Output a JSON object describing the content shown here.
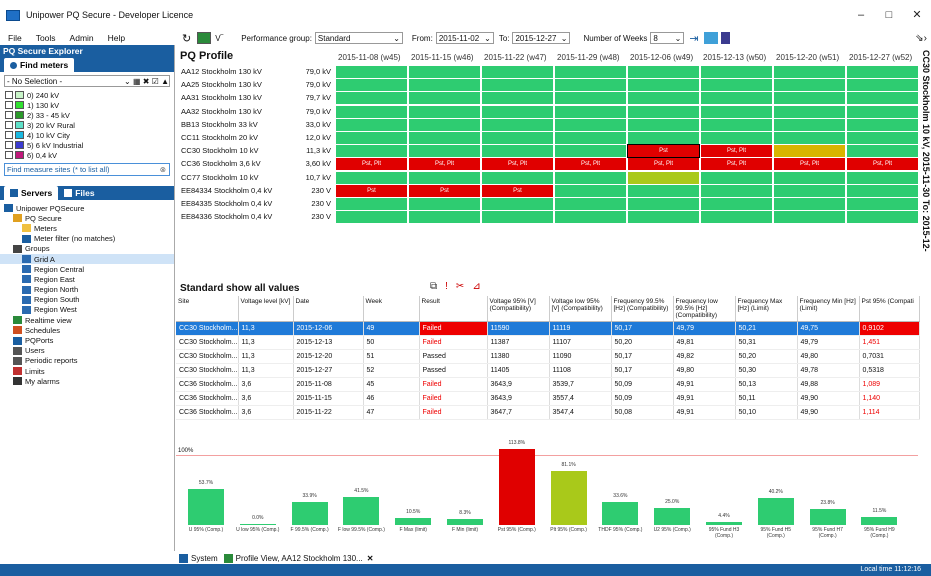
{
  "window": {
    "title": "Unipower PQ Secure - Developer Licence",
    "controls": [
      "–",
      "□",
      "✕"
    ]
  },
  "menu": [
    "File",
    "Tools",
    "Admin",
    "Help"
  ],
  "explorer": {
    "title": "PQ Secure Explorer",
    "tab": "Find meters",
    "selection": "- No Selection -",
    "levels": [
      {
        "label": "0) 240 kV",
        "color": "#c9f5c9"
      },
      {
        "label": "1) 130 kV",
        "color": "#30e030"
      },
      {
        "label": "2) 33 - 45 kV",
        "color": "#2a9a2a"
      },
      {
        "label": "3) 20 kV Rural",
        "color": "#5ee0c8"
      },
      {
        "label": "4) 10 kV City",
        "color": "#19b8e0"
      },
      {
        "label": "5) 6 kV Industrial",
        "color": "#3a3ad0"
      },
      {
        "label": "6) 0,4 kV",
        "color": "#c0187a"
      }
    ],
    "find_placeholder": "Find measure sites (* to list all)",
    "tabs2": [
      "Servers",
      "Files"
    ],
    "tree": [
      {
        "label": "Unipower PQSecure",
        "indent": 0,
        "icon": "server-icon"
      },
      {
        "label": "PQ Secure",
        "indent": 1,
        "icon": "lock-icon"
      },
      {
        "label": "Meters",
        "indent": 2,
        "icon": "folder-icon"
      },
      {
        "label": "Meter filter (no matches)",
        "indent": 2,
        "icon": "filter-icon"
      },
      {
        "label": "Groups",
        "indent": 1,
        "icon": "groups-icon"
      },
      {
        "label": "Grid A",
        "indent": 2,
        "icon": "group-icon"
      },
      {
        "label": "Region Central",
        "indent": 2,
        "icon": "group-icon"
      },
      {
        "label": "Region East",
        "indent": 2,
        "icon": "group-icon"
      },
      {
        "label": "Region North",
        "indent": 2,
        "icon": "group-icon"
      },
      {
        "label": "Region South",
        "indent": 2,
        "icon": "group-icon"
      },
      {
        "label": "Region West",
        "indent": 2,
        "icon": "group-icon"
      },
      {
        "label": "Realtime view",
        "indent": 1,
        "icon": "realtime-icon"
      },
      {
        "label": "Schedules",
        "indent": 1,
        "icon": "clock-icon"
      },
      {
        "label": "PQPorts",
        "indent": 1,
        "icon": "monitor-icon"
      },
      {
        "label": "Users",
        "indent": 1,
        "icon": "users-icon"
      },
      {
        "label": "Periodic reports",
        "indent": 1,
        "icon": "report-icon"
      },
      {
        "label": "Limits",
        "indent": 1,
        "icon": "limits-icon"
      },
      {
        "label": "My alarms",
        "indent": 1,
        "icon": "alarm-icon"
      }
    ]
  },
  "toolbar": {
    "perf_label": "Performance group:",
    "perf_value": "Standard",
    "from_label": "From:",
    "from_value": "2015-11-02",
    "to_label": "To:",
    "to_value": "2015-12-27",
    "weeks_label": "Number of Weeks",
    "weeks_value": "8"
  },
  "profile": {
    "title": "PQ Profile",
    "weeks": [
      "2015-11-08 (w45)",
      "2015-11-15 (w46)",
      "2015-11-22 (w47)",
      "2015-11-29 (w48)",
      "2015-12-06 (w49)",
      "2015-12-13 (w50)",
      "2015-12-20 (w51)",
      "2015-12-27 (w52)"
    ],
    "rows": [
      {
        "site": "AA12 Stockholm 130 kV",
        "value": "79,0 kV",
        "cells": [
          "g",
          "g",
          "g",
          "g",
          "g",
          "g",
          "g",
          "g"
        ]
      },
      {
        "site": "AA25 Stockholm 130 kV",
        "value": "79,0 kV",
        "cells": [
          "g",
          "g",
          "g",
          "g",
          "g",
          "g",
          "g",
          "g"
        ]
      },
      {
        "site": "AA31 Stockholm 130 kV",
        "value": "79,7 kV",
        "cells": [
          "g",
          "g",
          "g",
          "g",
          "g",
          "g",
          "g",
          "g"
        ]
      },
      {
        "site": "AA32 Stockholm 130 kV",
        "value": "79,0 kV",
        "cells": [
          "g",
          "g",
          "g",
          "g",
          "g",
          "g",
          "g",
          "g"
        ]
      },
      {
        "site": "BB13 Stockholm 33 kV",
        "value": "33,0 kV",
        "cells": [
          "g",
          "g",
          "g",
          "g",
          "g",
          "g",
          "g",
          "g"
        ]
      },
      {
        "site": "CC11 Stockholm 20 kV",
        "value": "12,0 kV",
        "cells": [
          "g",
          "g",
          "g",
          "g",
          "g",
          "g",
          "g",
          "g"
        ]
      },
      {
        "site": "CC30 Stockholm 10 kV",
        "value": "11,3 kV",
        "cells": [
          "g",
          "g",
          "g",
          "g",
          "r",
          "r",
          "y",
          "g"
        ],
        "labels": [
          "",
          "",
          "",
          "",
          "Pst",
          "Pst, Plt",
          "",
          ""
        ]
      },
      {
        "site": "CC36 Stockholm 3,6 kV",
        "value": "3,60 kV",
        "cells": [
          "r",
          "r",
          "r",
          "r",
          "r",
          "r",
          "r",
          "r"
        ],
        "labels": [
          "Pst, Plt",
          "Pst, Plt",
          "Pst, Plt",
          "Pst, Plt",
          "Pst, Plt",
          "Pst, Plt",
          "Pst, Plt",
          "Pst, Plt"
        ]
      },
      {
        "site": "CC77 Stockholm 10 kV",
        "value": "10,7 kV",
        "cells": [
          "g",
          "g",
          "g",
          "g",
          "o",
          "g",
          "g",
          "g"
        ]
      },
      {
        "site": "EE84334 Stockholm 0,4 kV",
        "value": "230 V",
        "cells": [
          "r",
          "r",
          "r",
          "g",
          "g",
          "g",
          "g",
          "g"
        ],
        "labels": [
          "Pst",
          "Pst",
          "Pst",
          "",
          "",
          "",
          "",
          ""
        ]
      },
      {
        "site": "EE84335 Stockholm 0,4 kV",
        "value": "230 V",
        "cells": [
          "g",
          "g",
          "g",
          "g",
          "g",
          "g",
          "g",
          "g"
        ]
      },
      {
        "site": "EE84336 Stockholm 0,4 kV",
        "value": "230 V",
        "cells": [
          "g",
          "g",
          "g",
          "g",
          "g",
          "g",
          "g",
          "g"
        ]
      }
    ],
    "side_text": "CC30 Stockholm 10 kV, 2015-11-30 To: 2015-12-"
  },
  "standard": {
    "title": "Standard show all values",
    "columns": [
      "Site",
      "Voltage level [kV]",
      "Date",
      "Week",
      "Result",
      "Voltage 95% [V] (Compatibility)",
      "Voltage low 95% [V] (Compatibility)",
      "Frequency 99.5% [Hz] (Compatibility)",
      "Frequency low 99.5% [Hz] (Compatibility)",
      "Frequency Max [Hz] (Limit)",
      "Frequency Min [Hz] (Limit)",
      "Pst 95% (Compati"
    ],
    "rows": [
      [
        "CC30 Stockholm...",
        "11,3",
        "2015-12-06",
        "49",
        "Failed",
        "11590",
        "11119",
        "50,17",
        "49,79",
        "50,21",
        "49,75",
        "0,9102"
      ],
      [
        "CC30 Stockholm...",
        "11,3",
        "2015-12-13",
        "50",
        "Failed",
        "11387",
        "11107",
        "50,20",
        "49,81",
        "50,31",
        "49,79",
        "1,451"
      ],
      [
        "CC30 Stockholm...",
        "11,3",
        "2015-12-20",
        "51",
        "Passed",
        "11380",
        "11090",
        "50,17",
        "49,82",
        "50,20",
        "49,80",
        "0,7031"
      ],
      [
        "CC30 Stockholm...",
        "11,3",
        "2015-12-27",
        "52",
        "Passed",
        "11405",
        "11108",
        "50,17",
        "49,80",
        "50,30",
        "49,78",
        "0,5318"
      ],
      [
        "CC36 Stockholm...",
        "3,6",
        "2015-11-08",
        "45",
        "Failed",
        "3643,9",
        "3539,7",
        "50,09",
        "49,91",
        "50,13",
        "49,88",
        "1,089"
      ],
      [
        "CC36 Stockholm...",
        "3,6",
        "2015-11-15",
        "46",
        "Failed",
        "3643,9",
        "3557,4",
        "50,09",
        "49,91",
        "50,11",
        "49,90",
        "1,140"
      ],
      [
        "CC36 Stockholm...",
        "3,6",
        "2015-11-22",
        "47",
        "Failed",
        "3647,7",
        "3547,4",
        "50,08",
        "49,91",
        "50,10",
        "49,90",
        "1,114"
      ]
    ]
  },
  "chart_data": {
    "type": "bar",
    "reference_label": "100%",
    "ylim": [
      0,
      120
    ],
    "categories": [
      "U 95% (Comp.)",
      "U low 95% (Comp.)",
      "F 99.5% (Comp.)",
      "F low 99.5% (Comp.)",
      "F Max (limit)",
      "F Min (limit)",
      "Pst 95% (Comp.)",
      "Plt 95% (Comp.)",
      "THDF 95% (Comp.)",
      "U2 95% (Comp.)",
      "95% Fund H3 (Comp.)",
      "95% Fund H5 (Comp.)",
      "95% Fund H7 (Comp.)",
      "95% Fund H9 (Comp.)"
    ],
    "values": [
      53.7,
      0.0,
      33.9,
      41.5,
      10.5,
      8.3,
      113.8,
      81.1,
      33.6,
      25.0,
      4.4,
      40.2,
      23.8,
      11.5
    ],
    "labels": [
      "53.7%",
      "0.0%",
      "33.9%",
      "41.5%",
      "10.5%",
      "8.3%",
      "113.8%",
      "81.1%",
      "33.6%",
      "25.0%",
      "4.4%",
      "40.2%",
      "23.8%",
      "11.5%"
    ],
    "colors": [
      "#2ecc71",
      "#2ecc71",
      "#2ecc71",
      "#2ecc71",
      "#2ecc71",
      "#2ecc71",
      "#e00000",
      "#a9c91a",
      "#2ecc71",
      "#2ecc71",
      "#2ecc71",
      "#2ecc71",
      "#2ecc71",
      "#2ecc71"
    ]
  },
  "bottom": {
    "tab1": "System",
    "tab2": "Profile View, AA12 Stockholm 130...",
    "status": "Local time 11:12:16"
  },
  "colors": {
    "green": "#2ecc71",
    "red": "#e00000",
    "yellow": "#d8b400",
    "olive": "#a9c91a",
    "accent": "#1a5ea0"
  }
}
